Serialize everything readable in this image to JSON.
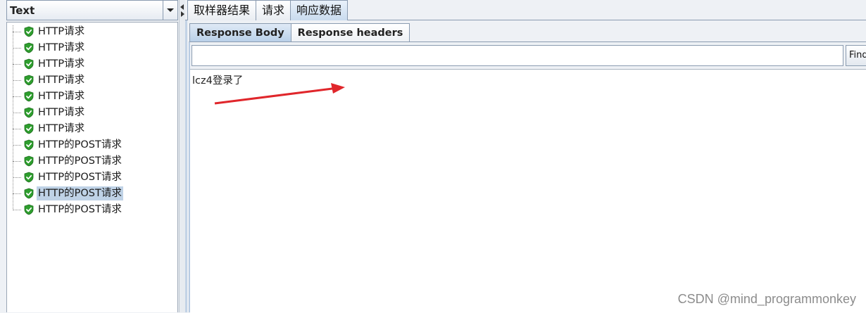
{
  "left": {
    "renderer_value": "Text",
    "tree_items": [
      {
        "label": "HTTP请求",
        "selected": false
      },
      {
        "label": "HTTP请求",
        "selected": false
      },
      {
        "label": "HTTP请求",
        "selected": false
      },
      {
        "label": "HTTP请求",
        "selected": false
      },
      {
        "label": "HTTP请求",
        "selected": false
      },
      {
        "label": "HTTP请求",
        "selected": false
      },
      {
        "label": "HTTP请求",
        "selected": false
      },
      {
        "label": "HTTP的POST请求",
        "selected": false
      },
      {
        "label": "HTTP的POST请求",
        "selected": false
      },
      {
        "label": "HTTP的POST请求",
        "selected": false
      },
      {
        "label": "HTTP的POST请求",
        "selected": true
      },
      {
        "label": "HTTP的POST请求",
        "selected": false
      }
    ]
  },
  "tabs": [
    {
      "label": "取样器结果",
      "active": false
    },
    {
      "label": "请求",
      "active": false
    },
    {
      "label": "响应数据",
      "active": true
    }
  ],
  "inner_tabs": [
    {
      "label": "Response Body",
      "active": true
    },
    {
      "label": "Response headers",
      "active": false
    }
  ],
  "search": {
    "value": "",
    "find_label": "Find"
  },
  "response": {
    "text": "lcz4登录了"
  },
  "watermark": "CSDN @mind_programmonkey",
  "colors": {
    "success_icon": "#2e9e2e",
    "selection": "#bfd2e6",
    "arrow": "#e0262b"
  }
}
